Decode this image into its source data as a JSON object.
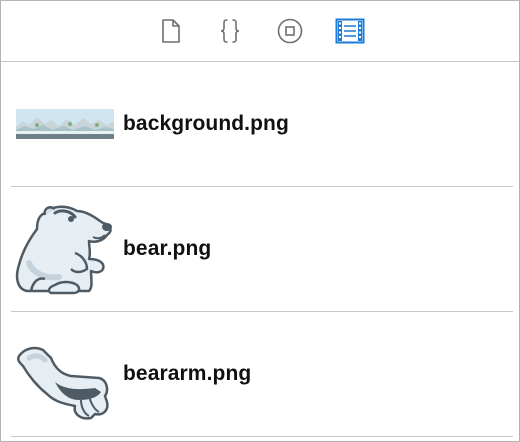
{
  "toolbar": {
    "buttons": [
      {
        "icon": "file-icon"
      },
      {
        "icon": "curly-braces-icon"
      },
      {
        "icon": "circle-square-icon"
      },
      {
        "icon": "film-strip-icon",
        "selected": true
      }
    ],
    "accent_color": "#1b7bd6",
    "icon_color": "#6f6f6f"
  },
  "files": [
    {
      "name": "background.png",
      "thumbnail": "landscape-thumbnail"
    },
    {
      "name": "bear.png",
      "thumbnail": "bear-thumbnail"
    },
    {
      "name": "beararm.png",
      "thumbnail": "bear-arm-thumbnail"
    }
  ]
}
